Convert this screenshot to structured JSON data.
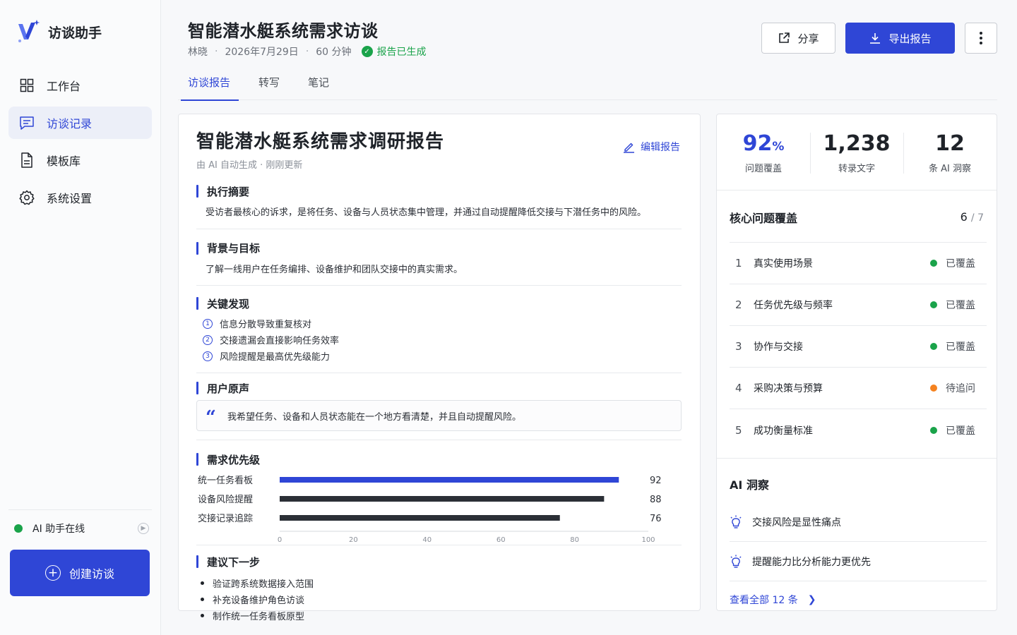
{
  "app": {
    "name": "访谈助手"
  },
  "nav": {
    "items": [
      {
        "label": "工作台"
      },
      {
        "label": "访谈记录"
      },
      {
        "label": "模板库"
      },
      {
        "label": "系统设置"
      }
    ]
  },
  "sidebar_bottom": {
    "ai_status": "AI 助手在线",
    "create_label": "创建访谈"
  },
  "header": {
    "title": "智能潜水艇系统需求访谈",
    "interviewer": "林晓",
    "date": "2026年7月29日",
    "duration": "60 分钟",
    "status": "报告已生成",
    "share_label": "分享",
    "export_label": "导出报告"
  },
  "tabs": [
    {
      "label": "访谈报告"
    },
    {
      "label": "转写"
    },
    {
      "label": "笔记"
    }
  ],
  "report": {
    "title": "智能潜水艇系统需求调研报告",
    "subtitle_source": "由 AI 自动生成",
    "subtitle_time": "刚刚更新",
    "edit_label": "编辑报告",
    "summary": {
      "heading": "执行摘要",
      "text": "受访者最核心的诉求，是将任务、设备与人员状态集中管理，并通过自动提醒降低交接与下潜任务中的风险。"
    },
    "background": {
      "heading": "背景与目标",
      "text": "了解一线用户在任务编排、设备维护和团队交接中的真实需求。"
    },
    "findings": {
      "heading": "关键发现",
      "items": [
        {
          "num": "1",
          "text": "信息分散导致重复核对"
        },
        {
          "num": "2",
          "text": "交接遗漏会直接影响任务效率"
        },
        {
          "num": "3",
          "text": "风险提醒是最高优先级能力"
        }
      ]
    },
    "voice": {
      "heading": "用户原声",
      "quote": "我希望任务、设备和人员状态能在一个地方看清楚，并且自动提醒风险。"
    },
    "priority": {
      "heading": "需求优先级"
    },
    "next": {
      "heading": "建议下一步",
      "items": [
        "验证跨系统数据接入范围",
        "补充设备维护角色访谈",
        "制作统一任务看板原型"
      ]
    }
  },
  "chart_data": {
    "type": "bar",
    "orientation": "horizontal",
    "categories": [
      "统一任务看板",
      "设备风险提醒",
      "交接记录追踪"
    ],
    "values": [
      92,
      88,
      76
    ],
    "xlim": [
      0,
      100
    ],
    "ticks": [
      0,
      20,
      40,
      60,
      80,
      100
    ],
    "colors": [
      "#2f46d6",
      "#2b2f36",
      "#2b2f36"
    ]
  },
  "stats": [
    {
      "value": "92",
      "unit": "%",
      "label": "问题覆盖"
    },
    {
      "value": "1,238",
      "label": "转录文字"
    },
    {
      "value": "12",
      "label": "条 AI 洞察"
    }
  ],
  "coverage": {
    "title": "核心问题覆盖",
    "covered": "6",
    "total": "/ 7",
    "items": [
      {
        "num": "1",
        "question": "真实使用场景",
        "status": "已覆盖",
        "color": "#1aa34a"
      },
      {
        "num": "2",
        "question": "任务优先级与频率",
        "status": "已覆盖",
        "color": "#1aa34a"
      },
      {
        "num": "3",
        "question": "协作与交接",
        "status": "已覆盖",
        "color": "#1aa34a"
      },
      {
        "num": "4",
        "question": "采购决策与预算",
        "status": "待追问",
        "color": "#f5821f"
      },
      {
        "num": "5",
        "question": "成功衡量标准",
        "status": "已覆盖",
        "color": "#1aa34a"
      }
    ]
  },
  "insights": {
    "title": "AI 洞察",
    "items": [
      "交接风险是显性痛点",
      "提醒能力比分析能力更优先"
    ],
    "view_all": "查看全部 12 条"
  },
  "colors": {
    "accent": "#2f46d6",
    "success": "#1aa34a",
    "warning": "#f5821f"
  }
}
